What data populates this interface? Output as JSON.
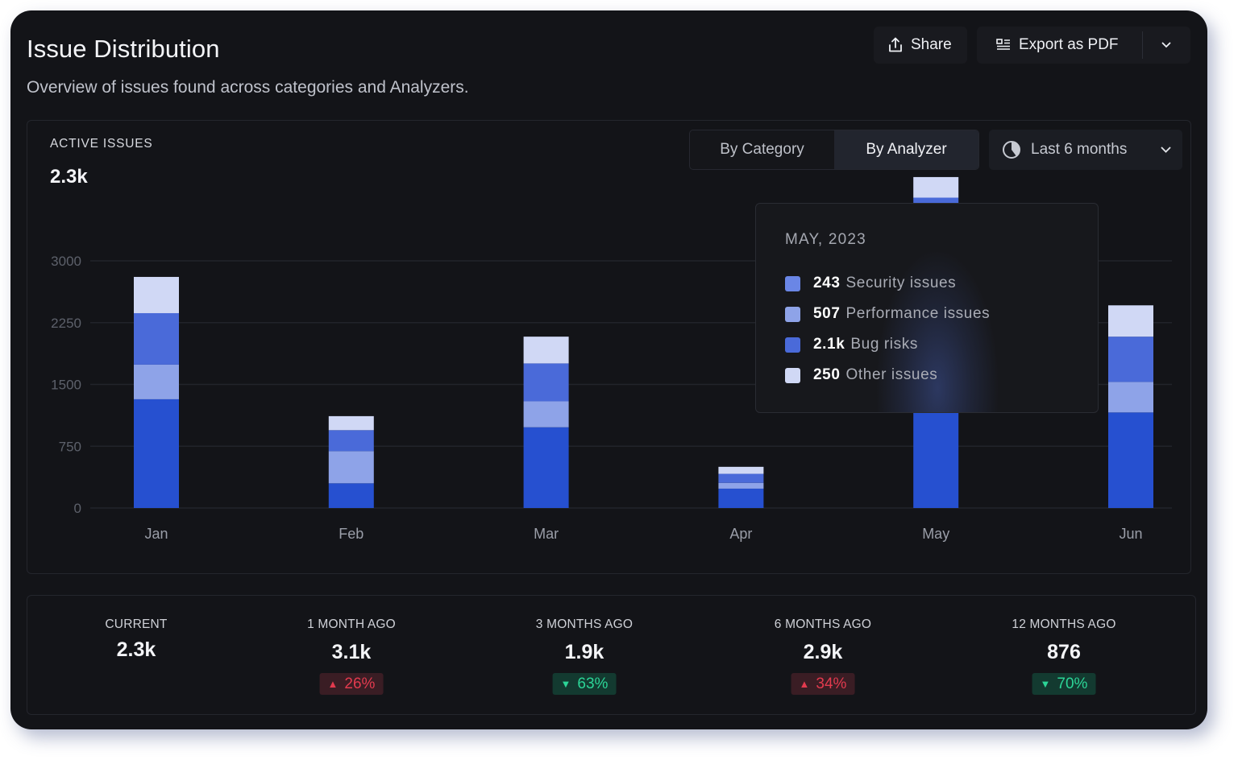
{
  "header": {
    "title": "Issue Distribution",
    "subtitle": "Overview of issues found across categories and Analyzers.",
    "share_label": "Share",
    "export_label": "Export as PDF"
  },
  "panel": {
    "active_label": "ACTIVE ISSUES",
    "active_value": "2.3k",
    "toggle": [
      {
        "label": "By Category",
        "selected": false
      },
      {
        "label": "By Analyzer",
        "selected": true
      }
    ],
    "range": {
      "label": "Last 6 months"
    }
  },
  "tooltip": {
    "title": "MAY, 2023",
    "rows": [
      {
        "value": "243",
        "label": "Security issues",
        "color": "#6a86e6"
      },
      {
        "value": "507",
        "label": "Performance issues",
        "color": "#8ea3e8"
      },
      {
        "value": "2.1k",
        "label": "Bug risks",
        "color": "#4a6ad9"
      },
      {
        "value": "250",
        "label": "Other issues",
        "color": "#d0d8f5"
      }
    ]
  },
  "chart_data": {
    "type": "bar",
    "stacked": true,
    "title": "",
    "xlabel": "",
    "ylabel": "",
    "categories": [
      "Jan",
      "Feb",
      "Mar",
      "Apr",
      "May",
      "Jun"
    ],
    "yticks": [
      0,
      750,
      1500,
      2250,
      3000
    ],
    "ylim": [
      0,
      3000
    ],
    "grid": true,
    "series": [
      {
        "name": "Security issues",
        "color": "#2650d0",
        "values": [
          1320,
          300,
          980,
          235,
          1160,
          1160
        ]
      },
      {
        "name": "Performance issues",
        "color": "#8ea3e8",
        "values": [
          420,
          390,
          315,
          70,
          507,
          370
        ]
      },
      {
        "name": "Bug risks",
        "color": "#4a6ad9",
        "values": [
          625,
          255,
          460,
          110,
          2100,
          550
        ]
      },
      {
        "name": "Other issues",
        "color": "#d0d8f5",
        "values": [
          440,
          170,
          325,
          85,
          250,
          380
        ]
      }
    ]
  },
  "stats": [
    {
      "label": "CURRENT",
      "value": "2.3k",
      "change": null
    },
    {
      "label": "1 MONTH AGO",
      "value": "3.1k",
      "change": {
        "dir": "up",
        "text": "26%"
      }
    },
    {
      "label": "3 MONTHS AGO",
      "value": "1.9k",
      "change": {
        "dir": "down",
        "text": "63%"
      }
    },
    {
      "label": "6 MONTHS AGO",
      "value": "2.9k",
      "change": {
        "dir": "up",
        "text": "34%"
      }
    },
    {
      "label": "12 MONTHS AGO",
      "value": "876",
      "change": {
        "dir": "down",
        "text": "70%"
      }
    }
  ],
  "colors": {
    "up": "#e23a4e",
    "down": "#2cd597",
    "background": "#131418"
  }
}
